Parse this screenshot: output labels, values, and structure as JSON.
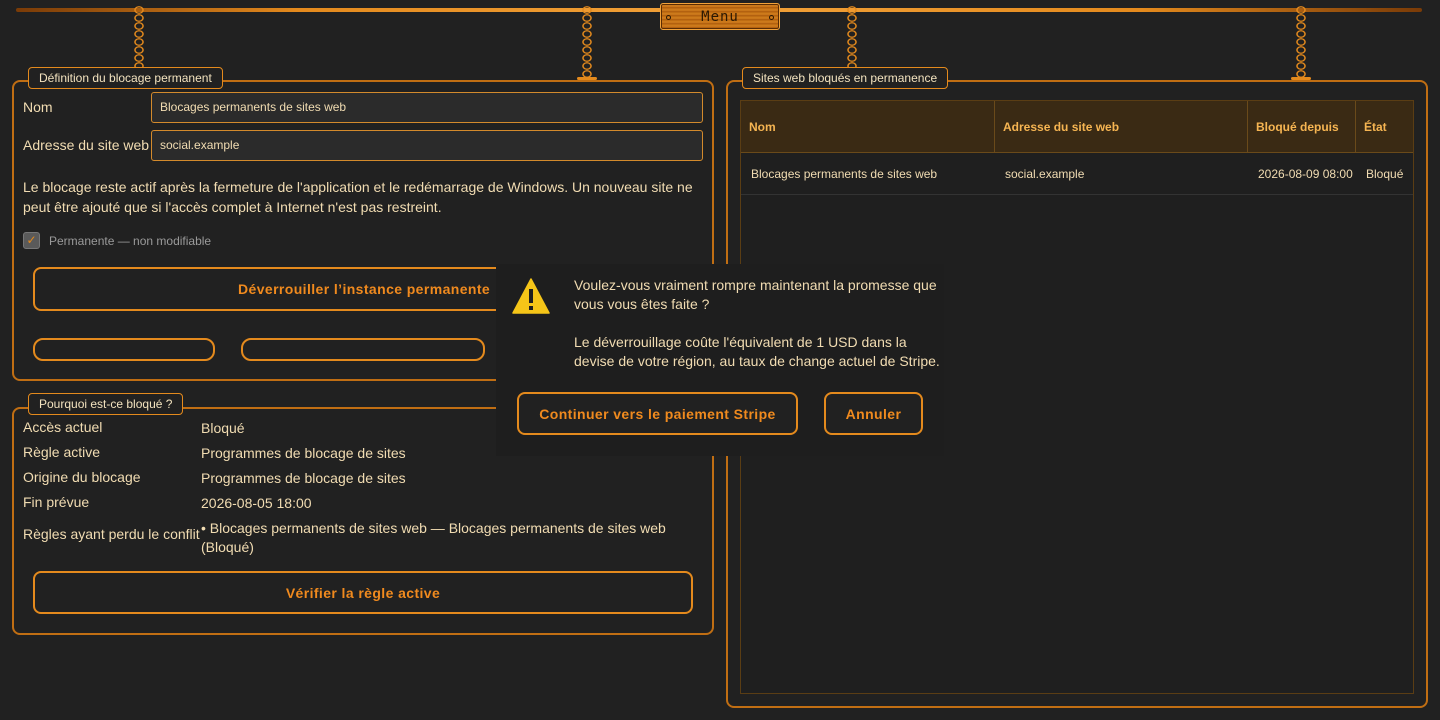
{
  "menu": {
    "label": "Menu"
  },
  "definition": {
    "legend": "Définition du blocage permanent",
    "name_label": "Nom",
    "name_value": "Blocages permanents de sites web",
    "site_label": "Adresse du site web",
    "site_value": "social.example",
    "description": "Le blocage reste actif après la fermeture de l'application et le redémarrage de Windows. Un nouveau site ne peut être ajouté que si l'accès complet à Internet n'est pas restreint.",
    "permanent_checked": true,
    "permanent_label": "Permanente — non modifiable",
    "unlock_button": "Déverrouiller l’instance permanente",
    "small_button_1": "",
    "small_button_2": ""
  },
  "why": {
    "legend": "Pourquoi est-ce bloqué ?",
    "rows": [
      {
        "key": "Accès actuel",
        "value": "Bloqué"
      },
      {
        "key": "Règle active",
        "value": "Programmes de blocage de sites"
      },
      {
        "key": "Origine du blocage",
        "value": "Programmes de blocage de sites"
      },
      {
        "key": "Fin prévue",
        "value": "2026-08-05 18:00"
      },
      {
        "key": "Règles ayant perdu le conflit",
        "value": "• Blocages permanents de sites web — Blocages permanents de sites web (Bloqué)"
      }
    ],
    "verify_button": "Vérifier la règle active"
  },
  "blocked_sites": {
    "legend": "Sites web bloqués en permanence",
    "columns": [
      "Nom",
      "Adresse du site web",
      "Bloqué depuis",
      "État"
    ],
    "rows": [
      [
        "Blocages permanents de sites web",
        "social.example",
        "2026-08-09 08:00",
        "Bloqué"
      ]
    ]
  },
  "dialog": {
    "icon": "warning-icon",
    "message_line1": "Voulez-vous vraiment rompre maintenant la promesse que vous vous êtes faite ?",
    "message_line2": "Le déverrouillage coûte l'équivalent de 1 USD dans la devise de votre région, au taux de change actuel de Stripe.",
    "confirm_button": "Continuer vers le paiement Stripe",
    "cancel_button": "Annuler"
  },
  "colors": {
    "accent": "#e48a1d",
    "background": "#212121",
    "text": "#f1dcb2",
    "warning": "#f5c518"
  }
}
